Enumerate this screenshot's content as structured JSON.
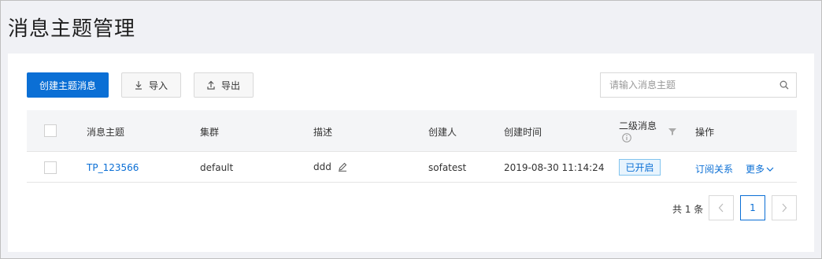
{
  "page": {
    "title": "消息主题管理"
  },
  "toolbar": {
    "create_label": "创建主题消息",
    "import_label": "导入",
    "export_label": "导出",
    "search_placeholder": "请输入消息主题",
    "icons": {
      "import": "download-icon",
      "export": "upload-icon",
      "search": "search-icon"
    }
  },
  "table": {
    "columns": [
      "消息主题",
      "集群",
      "描述",
      "创建人",
      "创建时间",
      "二级消息",
      "操作"
    ],
    "rows": [
      {
        "topic": "TP_123566",
        "cluster": "default",
        "description": "ddd",
        "creator": "sofatest",
        "created_at": "2019-08-30 11:14:24",
        "secondary_status": "已开启",
        "action_subscribe": "订阅关系",
        "action_more": "更多"
      }
    ]
  },
  "pagination": {
    "total_text": "共 1 条",
    "current_page": "1"
  },
  "colors": {
    "primary": "#0b6fd5",
    "badge_border": "#82c4ef",
    "badge_bg": "#e8f4fd",
    "page_bg": "#f0f1f5"
  }
}
